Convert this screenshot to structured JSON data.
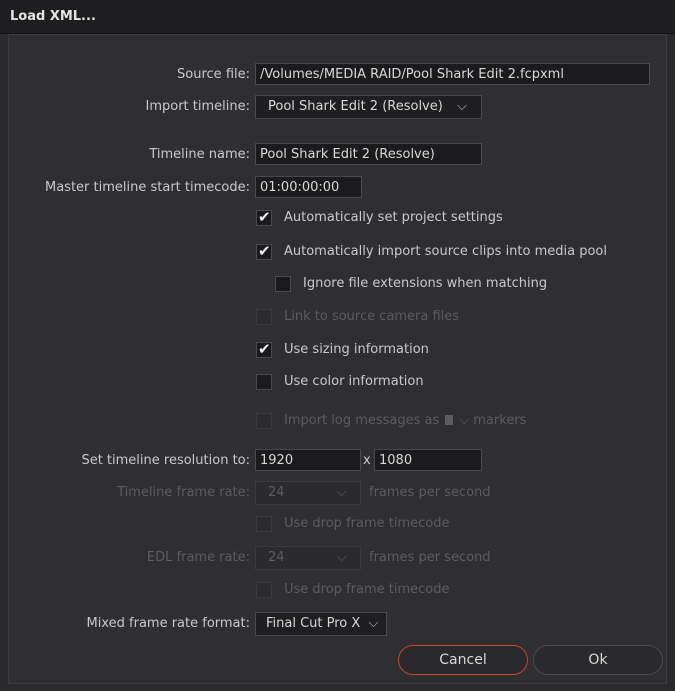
{
  "window": {
    "title": "Load XML..."
  },
  "form": {
    "source_file": {
      "label": "Source file:",
      "value": "/Volumes/MEDIA RAID/Pool Shark Edit 2.fcpxml"
    },
    "import_timeline": {
      "label": "Import timeline:",
      "value": "Pool Shark Edit 2 (Resolve)"
    },
    "timeline_name": {
      "label": "Timeline name:",
      "value": "Pool Shark Edit 2 (Resolve)"
    },
    "master_start_tc": {
      "label": "Master timeline start timecode:",
      "value": "01:00:00:00"
    },
    "checkboxes": {
      "auto_project_settings": {
        "label": "Automatically set project settings",
        "checked": true
      },
      "auto_import_clips": {
        "label": "Automatically import source clips into media pool",
        "checked": true
      },
      "ignore_extensions": {
        "label": "Ignore file extensions when matching",
        "checked": false
      },
      "link_camera_files": {
        "label": "Link to source camera files",
        "checked": false,
        "disabled": true
      },
      "use_sizing": {
        "label": "Use sizing information",
        "checked": true
      },
      "use_color": {
        "label": "Use color information",
        "checked": false
      },
      "import_log_messages": {
        "label": "Import log messages as",
        "suffix": "markers",
        "checked": false,
        "disabled": true
      },
      "drop_frame_tc_1": {
        "label": "Use drop frame timecode",
        "checked": false,
        "disabled": true
      },
      "drop_frame_tc_2": {
        "label": "Use drop frame timecode",
        "checked": false,
        "disabled": true
      }
    },
    "resolution": {
      "label": "Set timeline resolution to:",
      "width": "1920",
      "separator": "x",
      "height": "1080"
    },
    "timeline_frame_rate": {
      "label": "Timeline frame rate:",
      "value": "24",
      "unit": "frames per second"
    },
    "edl_frame_rate": {
      "label": "EDL frame rate:",
      "value": "24",
      "unit": "frames per second"
    },
    "mixed_frame_rate": {
      "label": "Mixed frame rate format:",
      "value": "Final Cut Pro X"
    }
  },
  "buttons": {
    "cancel": "Cancel",
    "ok": "Ok"
  },
  "icons": {
    "chevron": "⌵",
    "check": "✔"
  },
  "colors": {
    "cancel_border": "#c8452f"
  }
}
